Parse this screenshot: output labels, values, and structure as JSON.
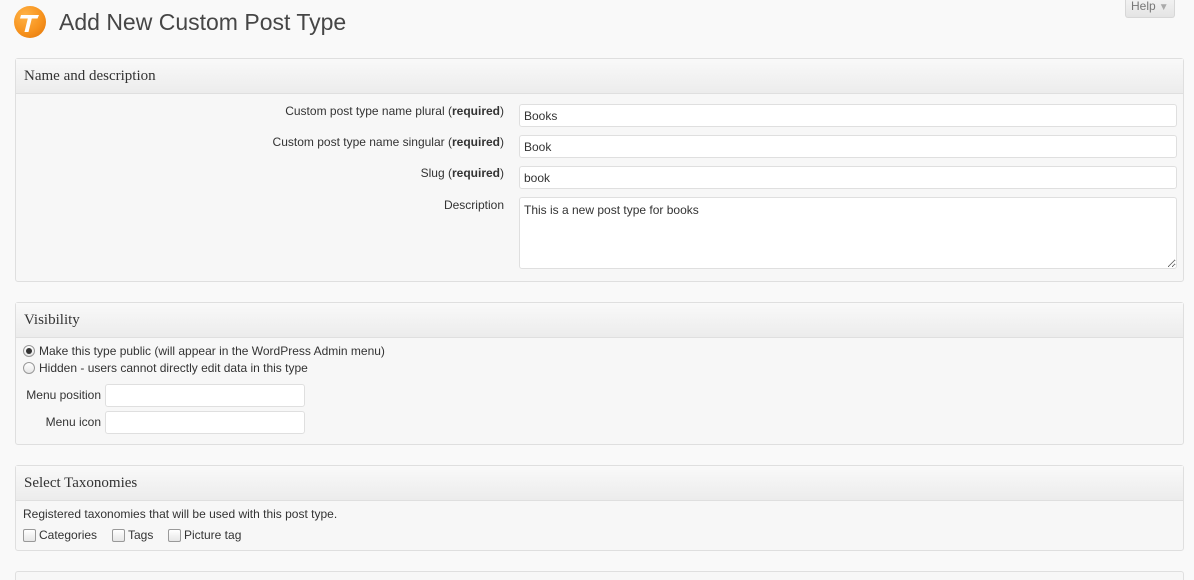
{
  "header": {
    "title": "Add New Custom Post Type",
    "help_label": "Help",
    "help_arrow": "▼",
    "logo_letter": "T"
  },
  "name_box": {
    "title": "Name and description",
    "fields": [
      {
        "label": "Custom post type name plural",
        "required": "required",
        "value": "Books"
      },
      {
        "label": "Custom post type name singular",
        "required": "required",
        "value": "Book"
      },
      {
        "label": "Slug",
        "required": "required",
        "value": "book"
      }
    ],
    "description_label": "Description",
    "description_value": "This is a new post type for books"
  },
  "visibility_box": {
    "title": "Visibility",
    "options": [
      {
        "label": "Make this type public (will appear in the WordPress Admin menu)",
        "checked": true
      },
      {
        "label": "Hidden - users cannot directly edit data in this type",
        "checked": false
      }
    ],
    "menu_position_label": "Menu position",
    "menu_position_value": "",
    "menu_icon_label": "Menu icon",
    "menu_icon_value": ""
  },
  "taxonomies_box": {
    "title": "Select Taxonomies",
    "description": "Registered taxonomies that will be used with this post type.",
    "items": [
      {
        "label": "Categories",
        "checked": false
      },
      {
        "label": "Tags",
        "checked": false
      },
      {
        "label": "Picture tag",
        "checked": false
      }
    ]
  }
}
